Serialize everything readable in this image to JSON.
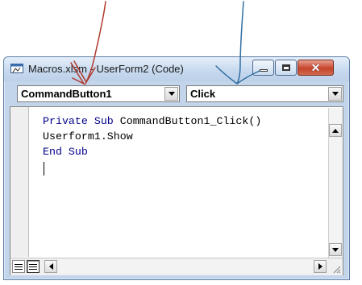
{
  "window": {
    "title": "Macros.xlsm - UserForm2 (Code)"
  },
  "object_combo": {
    "value": "CommandButton1"
  },
  "procedure_combo": {
    "value": "Click"
  },
  "code_lines": [
    {
      "kw1": "Private Sub",
      "rest": " CommandButton1_Click()"
    },
    {
      "text": "Userform1.Show"
    },
    {
      "text": "End Sub"
    }
  ],
  "colors": {
    "keyword": "#00008b",
    "arrow_left": "#b03a2e",
    "arrow_right": "#2f6ea3"
  },
  "icons": [
    "code-window-icon",
    "minimize-icon",
    "maximize-icon",
    "close-icon",
    "dropdown-arrow-icon",
    "scroll-up-icon",
    "scroll-down-icon",
    "scroll-left-icon",
    "scroll-right-icon",
    "procedure-view-icon",
    "full-module-view-icon",
    "resize-grip-icon"
  ]
}
